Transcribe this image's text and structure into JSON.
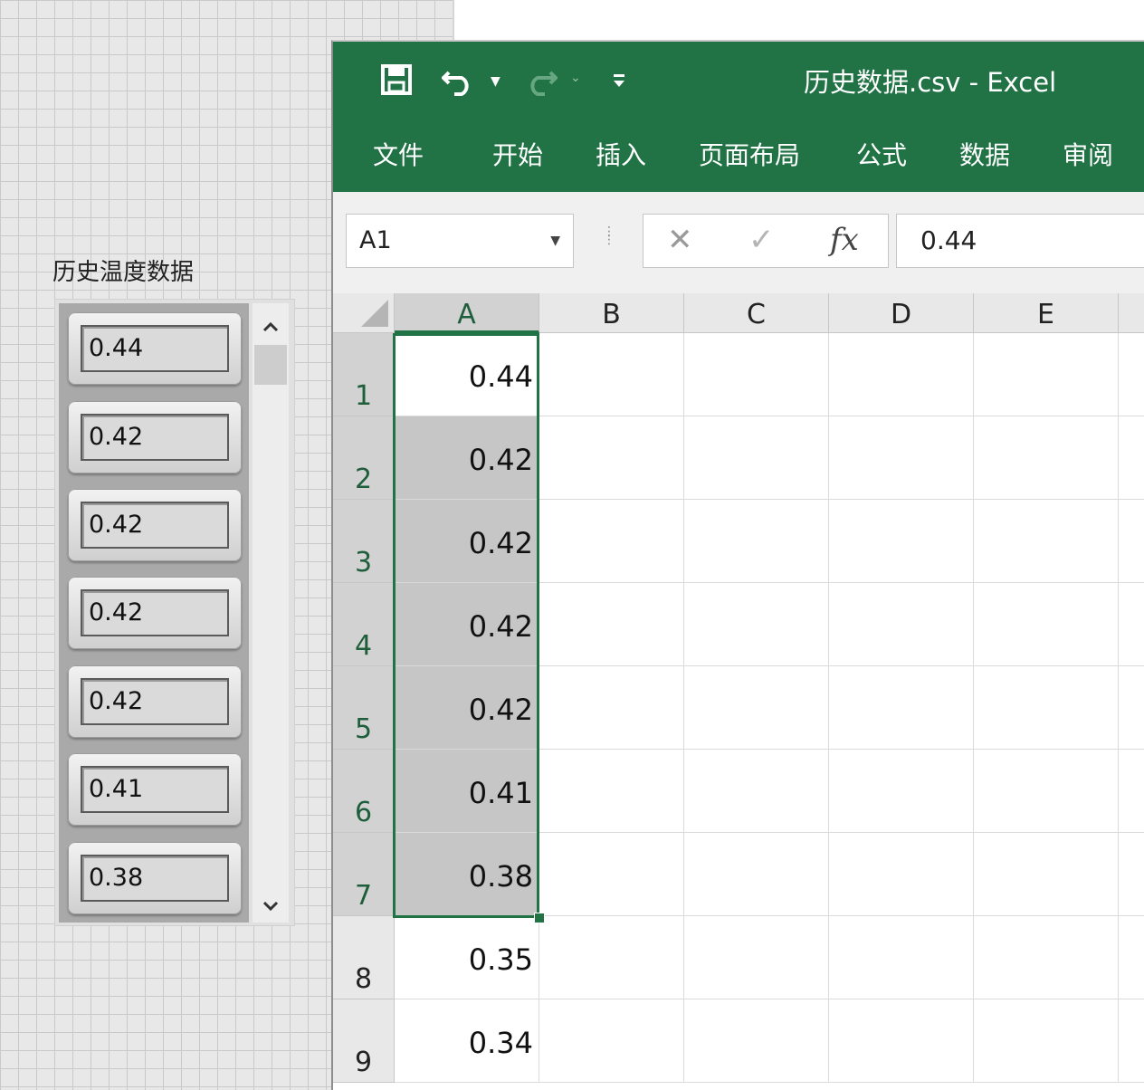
{
  "labview": {
    "label": "历史温度数据",
    "elements": [
      "0.44",
      "0.42",
      "0.42",
      "0.42",
      "0.42",
      "0.41",
      "0.38"
    ],
    "scroll_up_icon": "chevron-up-icon",
    "scroll_down_icon": "chevron-down-icon"
  },
  "excel": {
    "title": "历史数据.csv  -  Excel",
    "accent_color": "#217346",
    "tabs": [
      "文件",
      "开始",
      "插入",
      "页面布局",
      "公式",
      "数据",
      "审阅"
    ],
    "name_box": "A1",
    "formula_value": "0.44",
    "fx_label": "fx",
    "columns": [
      "A",
      "B",
      "C",
      "D",
      "E"
    ],
    "rows": [
      "1",
      "2",
      "3",
      "4",
      "5",
      "6",
      "7",
      "8",
      "9"
    ],
    "column_a": [
      "0.44",
      "0.42",
      "0.42",
      "0.42",
      "0.42",
      "0.41",
      "0.38",
      "0.35",
      "0.34"
    ],
    "selection": "A1:A7"
  }
}
